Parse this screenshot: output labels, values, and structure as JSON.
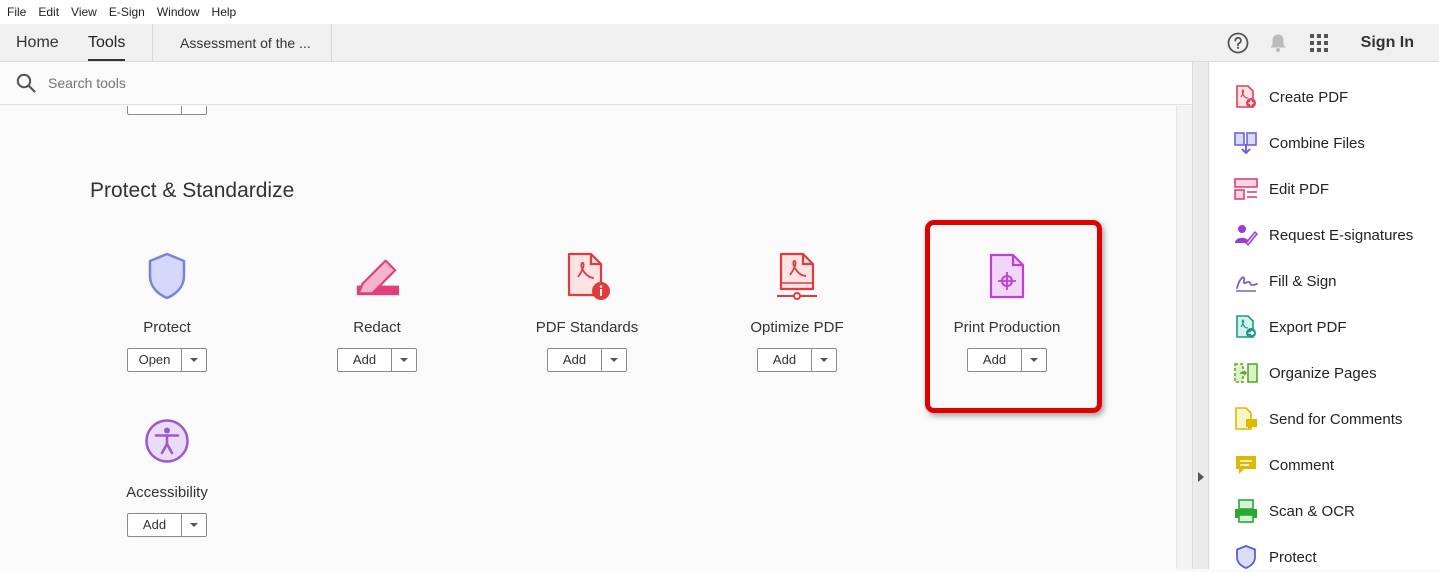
{
  "menu": [
    "File",
    "Edit",
    "View",
    "E-Sign",
    "Window",
    "Help"
  ],
  "tabs": {
    "home": "Home",
    "tools": "Tools",
    "document": "Assessment of the ..."
  },
  "header": {
    "sign_in": "Sign In"
  },
  "search": {
    "placeholder": "Search tools"
  },
  "partial_button": {
    "label": "Add"
  },
  "section": {
    "title": "Protect & Standardize"
  },
  "tools": [
    {
      "label": "Protect",
      "button": "Open",
      "icon": "shield-icon",
      "color": "#7b7fe0"
    },
    {
      "label": "Redact",
      "button": "Add",
      "icon": "redact-marker-icon",
      "color": "#e0407a"
    },
    {
      "label": "PDF Standards",
      "button": "Add",
      "icon": "pdf-standards-icon",
      "color": "#e03c3c"
    },
    {
      "label": "Optimize PDF",
      "button": "Add",
      "icon": "optimize-pdf-icon",
      "color": "#e03c3c"
    },
    {
      "label": "Print Production",
      "button": "Add",
      "icon": "print-production-icon",
      "color": "#c23cd6"
    },
    {
      "label": "Accessibility",
      "button": "Add",
      "icon": "accessibility-icon",
      "color": "#9b59d0"
    }
  ],
  "right_panel": {
    "items": [
      {
        "label": "Create PDF",
        "icon": "create-pdf-icon",
        "color": "#e0405a"
      },
      {
        "label": "Combine Files",
        "icon": "combine-files-icon",
        "color": "#6b63e0"
      },
      {
        "label": "Edit PDF",
        "icon": "edit-pdf-icon",
        "color": "#e0407a"
      },
      {
        "label": "Request E-signatures",
        "icon": "request-esignatures-icon",
        "color": "#9b3cd6"
      },
      {
        "label": "Fill & Sign",
        "icon": "fill-sign-icon",
        "color": "#7b5fd6"
      },
      {
        "label": "Export PDF",
        "icon": "export-pdf-icon",
        "color": "#1a9a8a"
      },
      {
        "label": "Organize Pages",
        "icon": "organize-pages-icon",
        "color": "#5aa820"
      },
      {
        "label": "Send for Comments",
        "icon": "send-for-comments-icon",
        "color": "#e0b800"
      },
      {
        "label": "Comment",
        "icon": "comment-icon",
        "color": "#e0b800"
      },
      {
        "label": "Scan & OCR",
        "icon": "scan-ocr-icon",
        "color": "#2aa830"
      },
      {
        "label": "Protect",
        "icon": "protect-icon",
        "color": "#5a5fd6"
      }
    ]
  },
  "highlight_color": "#e00000"
}
